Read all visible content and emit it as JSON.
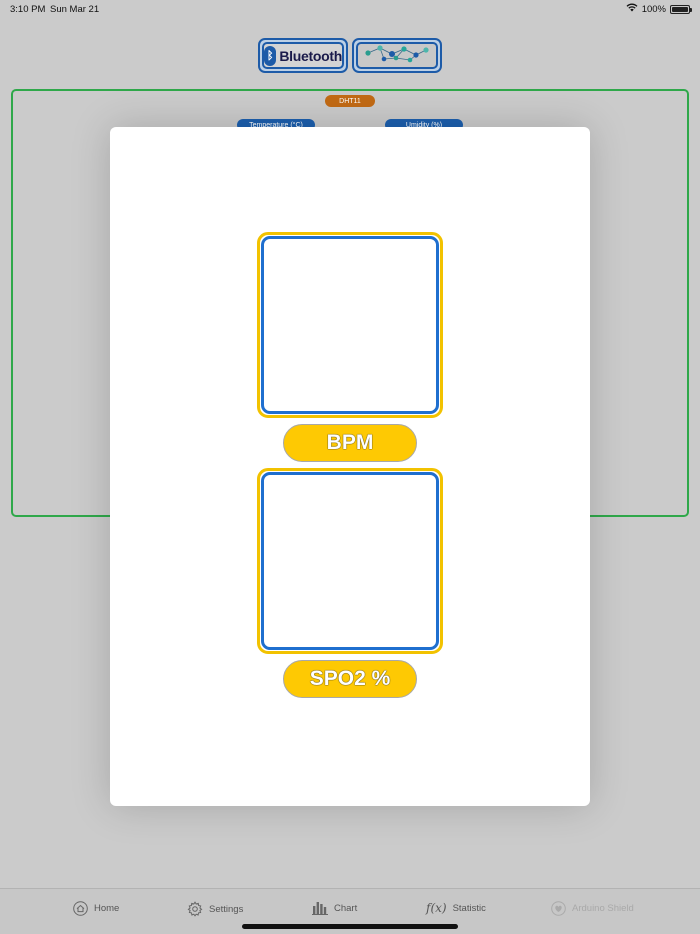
{
  "status_bar": {
    "time": "3:10 PM",
    "date": "Sun Mar 21",
    "battery": "100%",
    "battery_level": 1.0
  },
  "top_buttons": {
    "bluetooth_label": "Bluetooth"
  },
  "background_panel": {
    "badge": "DHT11",
    "temperature_label": "Temperature (°C)",
    "humidity_label": "Umidity (%)"
  },
  "modal": {
    "bpm_label": "BPM",
    "spo2_label": "SPO2 %"
  },
  "tab_bar": {
    "items": [
      {
        "label": "Home",
        "icon": "home-icon"
      },
      {
        "label": "Settings",
        "icon": "gear-icon"
      },
      {
        "label": "Chart",
        "icon": "bar-chart-icon"
      },
      {
        "label": "Statistic",
        "icon": "function-icon",
        "icon_text": "f(x)"
      },
      {
        "label": "Arduino Shield",
        "icon": "heart-icon"
      }
    ]
  },
  "colors": {
    "accent_yellow": "#fec903",
    "accent_blue": "#1f6fcf",
    "panel_green": "#2fa84a",
    "badge_orange": "#c26a14"
  }
}
